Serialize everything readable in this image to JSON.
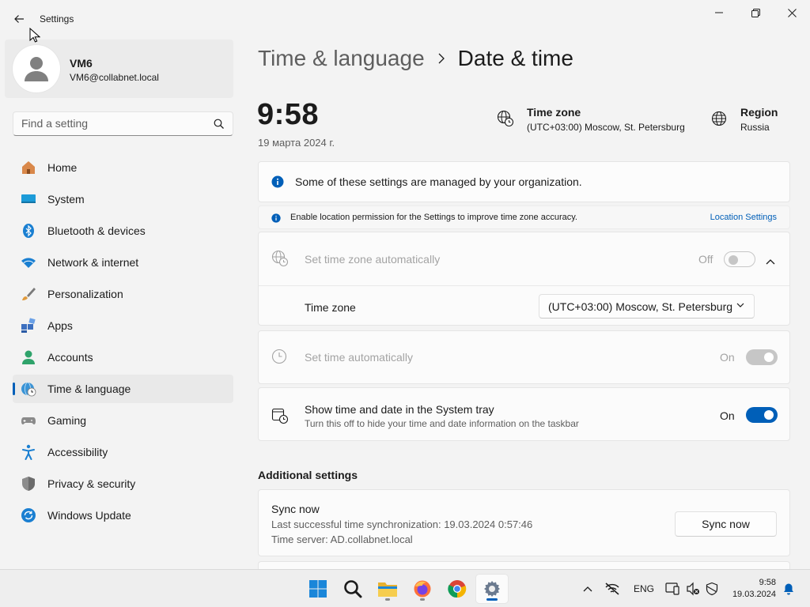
{
  "window": {
    "title": "Settings"
  },
  "profile": {
    "name": "VM6",
    "email": "VM6@collabnet.local"
  },
  "search": {
    "placeholder": "Find a setting"
  },
  "sidebar": {
    "items": [
      {
        "label": "Home",
        "icon": "home-icon"
      },
      {
        "label": "System",
        "icon": "system-icon"
      },
      {
        "label": "Bluetooth & devices",
        "icon": "bluetooth-icon"
      },
      {
        "label": "Network & internet",
        "icon": "wifi-icon"
      },
      {
        "label": "Personalization",
        "icon": "brush-icon"
      },
      {
        "label": "Apps",
        "icon": "apps-icon"
      },
      {
        "label": "Accounts",
        "icon": "accounts-icon"
      },
      {
        "label": "Time & language",
        "icon": "globe-clock-icon",
        "active": true
      },
      {
        "label": "Gaming",
        "icon": "gamepad-icon"
      },
      {
        "label": "Accessibility",
        "icon": "accessibility-icon"
      },
      {
        "label": "Privacy & security",
        "icon": "shield-icon"
      },
      {
        "label": "Windows Update",
        "icon": "update-icon"
      }
    ]
  },
  "breadcrumb": {
    "parent": "Time & language",
    "current": "Date & time"
  },
  "clock": {
    "time": "9:58",
    "date": "19 марта 2024 г."
  },
  "timezone_info": {
    "title": "Time zone",
    "value": "(UTC+03:00) Moscow, St. Petersburg"
  },
  "region_info": {
    "title": "Region",
    "value": "Russia"
  },
  "managed_notice": {
    "text": "Some of these settings are managed by your organization."
  },
  "location_notice": {
    "text": "Enable location permission for the Settings to improve time zone accuracy.",
    "link": "Location Settings"
  },
  "auto_timezone": {
    "label": "Set time zone automatically",
    "state": "Off",
    "enabled": false
  },
  "timezone_row": {
    "label": "Time zone",
    "selected": "(UTC+03:00) Moscow, St. Petersburg"
  },
  "auto_time": {
    "label": "Set time automatically",
    "state": "On",
    "enabled": false
  },
  "system_tray": {
    "label": "Show time and date in the System tray",
    "sub": "Turn this off to hide your time and date information on the taskbar",
    "state": "On"
  },
  "additional": {
    "title": "Additional settings"
  },
  "sync": {
    "title": "Sync now",
    "last_sync": "Last successful time synchronization: 19.03.2024 0:57:46",
    "server": "Time server: AD.collabnet.local",
    "button": "Sync now"
  },
  "taskbar": {
    "apps": [
      "start-icon",
      "search-icon",
      "file-explorer-icon",
      "firefox-icon",
      "chrome-icon",
      "settings-icon"
    ],
    "lang": "ENG",
    "time": "9:58",
    "date": "19.03.2024"
  },
  "colors": {
    "accent": "#005fb8",
    "background": "#f3f3f3",
    "card": "#fbfbfb"
  }
}
